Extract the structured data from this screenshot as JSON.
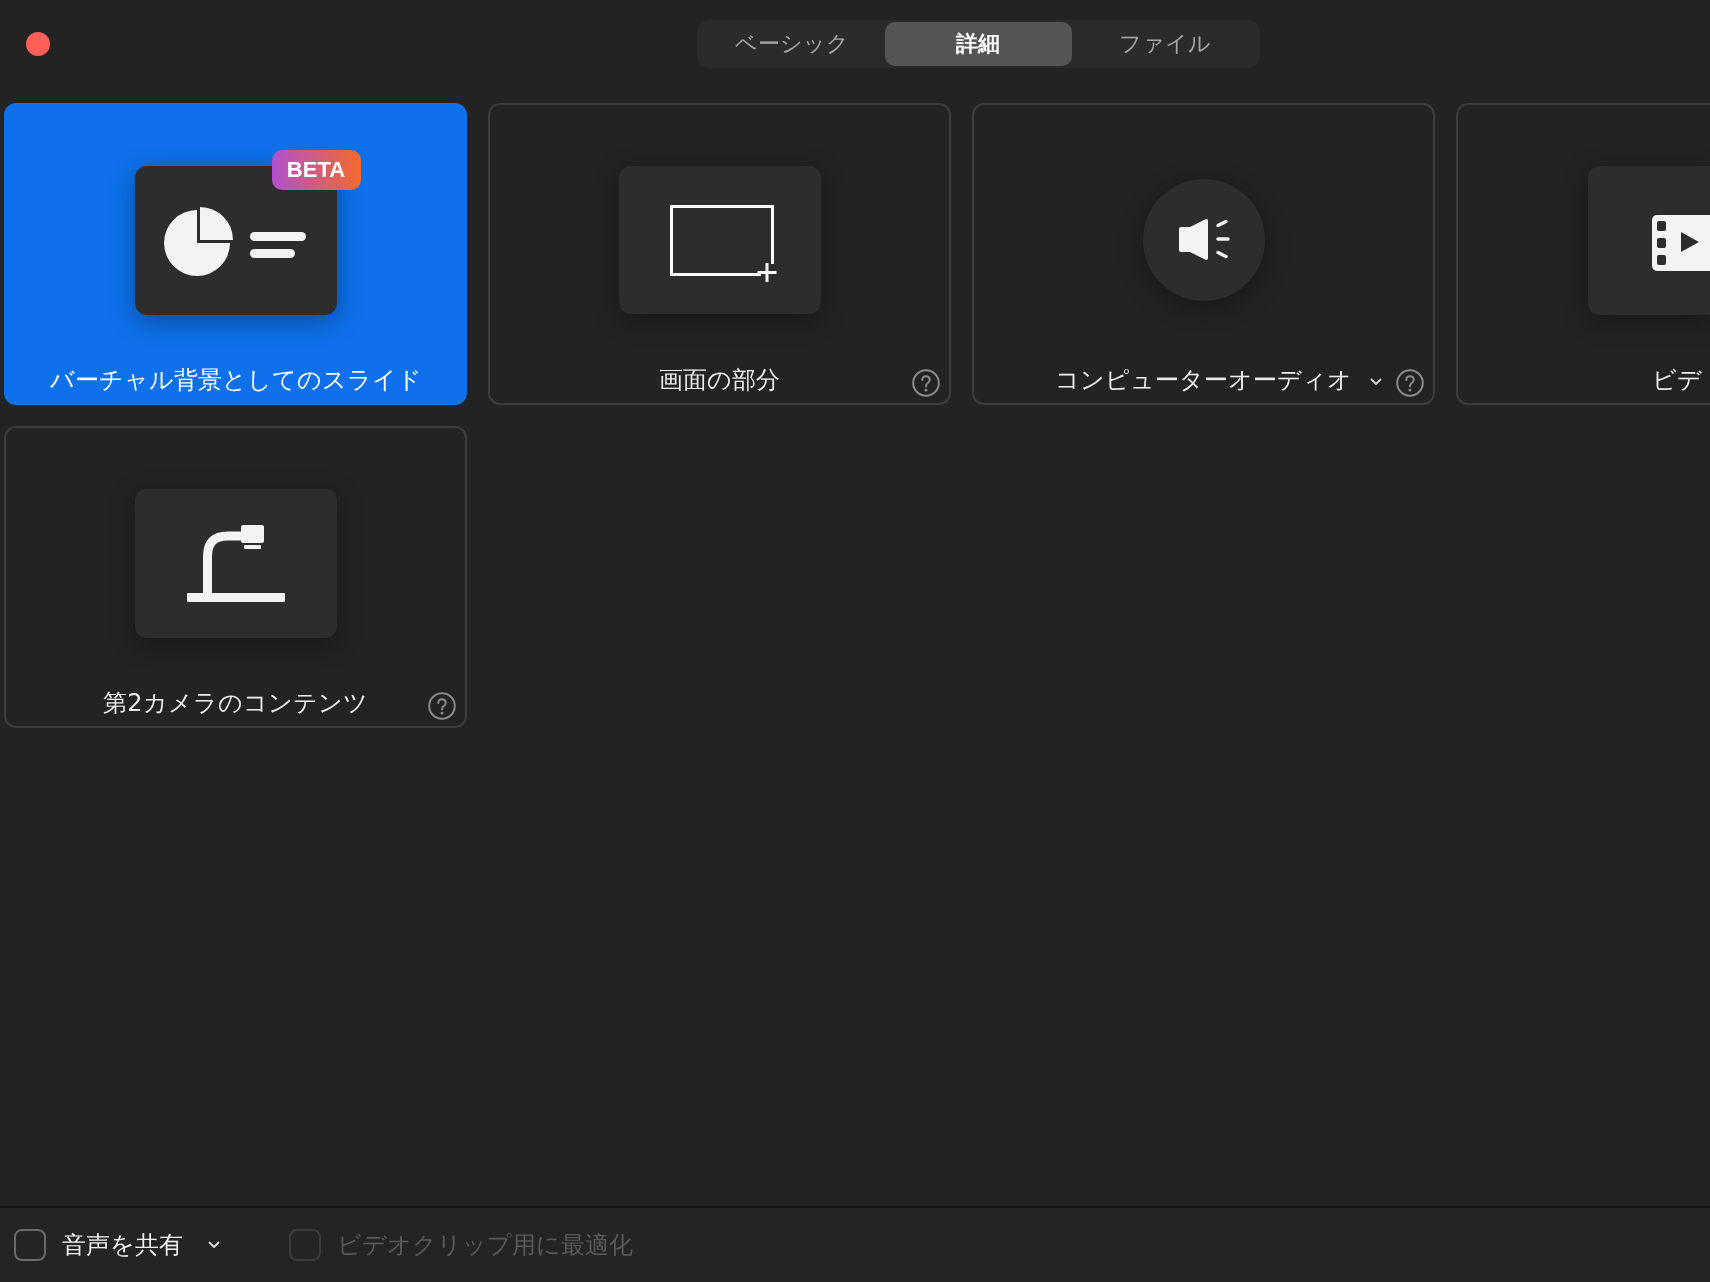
{
  "tabs": [
    {
      "label": "ベーシック",
      "selected": false
    },
    {
      "label": "詳細",
      "selected": true
    },
    {
      "label": "ファイル",
      "selected": false
    }
  ],
  "cards": [
    {
      "kind": "slides",
      "label": "バーチャル背景としてのスライド",
      "badge": "BETA",
      "selected": true,
      "dropdown": false,
      "help": false
    },
    {
      "kind": "portion",
      "label": "画面の部分",
      "selected": false,
      "dropdown": false,
      "help": true
    },
    {
      "kind": "audio",
      "label": "コンピューターオーディオ",
      "selected": false,
      "dropdown": true,
      "help": true
    },
    {
      "kind": "video",
      "label": "ビデ",
      "selected": false,
      "dropdown": false,
      "help": false
    },
    {
      "kind": "camera",
      "label": "第2カメラのコンテンツ",
      "selected": false,
      "dropdown": false,
      "help": true
    }
  ],
  "options": [
    {
      "label": "音声を共有",
      "checked": false,
      "disabled": false,
      "dropdown": true
    },
    {
      "label": "ビデオクリップ用に最適化",
      "checked": false,
      "disabled": true,
      "dropdown": false
    }
  ]
}
